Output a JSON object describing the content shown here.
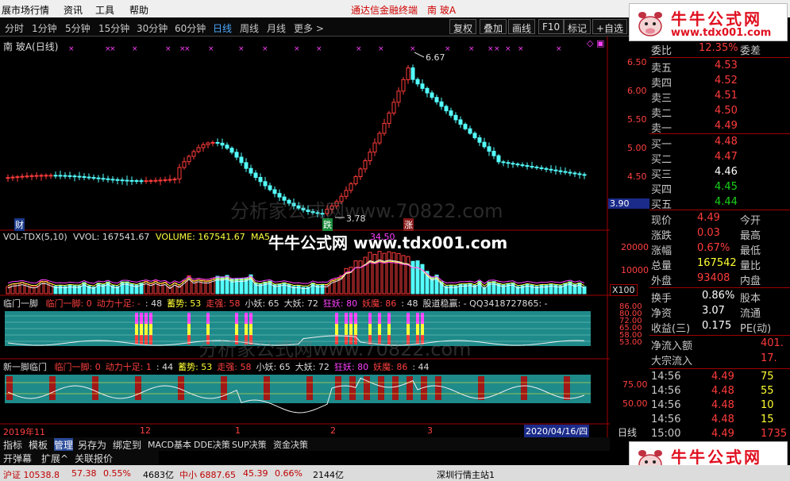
{
  "menubar": {
    "items": [
      "展市场行情",
      "资讯",
      "工具",
      "帮助"
    ],
    "center_title": "通达信金融终端",
    "stock_title": "南 玻A"
  },
  "toolbar": {
    "periods": [
      "分时",
      "1分钟",
      "5分钟",
      "15分钟",
      "30分钟",
      "60分钟",
      "日线",
      "周线",
      "月线",
      "更多 >"
    ],
    "active_period": "日线",
    "buttons": [
      "复权",
      "叠加",
      "画线",
      "F10",
      "标记",
      "+自选"
    ]
  },
  "logo": {
    "line1": "牛牛公式网",
    "line2": "www.tdx001.com"
  },
  "watermark": {
    "main": "牛牛公式网 www.tdx001.com",
    "faint1": "分析家公式网www.70822.com",
    "faint2": "分析家公式网www.70822.com"
  },
  "chart": {
    "title": "南 玻A(日线)",
    "price_axis": [
      "6.50",
      "6.00",
      "5.50",
      "5.00",
      "4.50"
    ],
    "current_price_tag": "3.90",
    "high_label": "6.67",
    "low_label": "3.78",
    "tag_cai": "财",
    "tag_die": "跌",
    "tag_zhang": "涨",
    "vol_header": {
      "name": "VOL-TDX(5,10)",
      "vvol": "VVOL: 167541.67",
      "volume": "VOLUME: 167541.67",
      "ma5": "MA5",
      "ma10_tail": "34.50"
    },
    "vol_axis": [
      "20000",
      "10000"
    ],
    "vol_unit": "X100",
    "ind1": {
      "name": "临门一脚",
      "items": [
        {
          "text": "临门一脚: 0",
          "color": "#ff4040"
        },
        {
          "text": "动力十足: -",
          "color": "#ff4040"
        },
        {
          "text": ": 48",
          "color": "#dddddd"
        },
        {
          "text": "蓄势: 53",
          "color": "#ffff33"
        },
        {
          "text": "走强: 58",
          "color": "#ff4040"
        },
        {
          "text": "小妖: 65",
          "color": "#dddddd"
        },
        {
          "text": "大妖: 72",
          "color": "#dddddd"
        },
        {
          "text": "狂妖: 80",
          "color": "#ff40ff"
        },
        {
          "text": "妖魔: 86",
          "color": "#ff4040"
        },
        {
          "text": ": 48",
          "color": "#dddddd"
        },
        {
          "text": "股道稳赢: - QQ3418727865: -",
          "color": "#dddddd"
        }
      ],
      "axis": [
        "86.00",
        "80.00",
        "72.00",
        "65.00",
        "58.00",
        "53.00"
      ]
    },
    "ind2": {
      "name": "新一脚临门",
      "items": [
        {
          "text": "临门一脚: 0",
          "color": "#ff4040"
        },
        {
          "text": "动力十足: 1",
          "color": "#ff4040"
        },
        {
          "text": ": 44",
          "color": "#dddddd"
        },
        {
          "text": "蓄势: 53",
          "color": "#ffff33"
        },
        {
          "text": "走强: 58",
          "color": "#ff4040"
        },
        {
          "text": "小妖: 65",
          "color": "#dddddd"
        },
        {
          "text": "大妖: 72",
          "color": "#dddddd"
        },
        {
          "text": "狂妖: 80",
          "color": "#ff40ff"
        },
        {
          "text": "妖魔: 86",
          "color": "#ff4040"
        },
        {
          "text": ": 44",
          "color": "#dddddd"
        }
      ],
      "axis": [
        "75.00",
        "50.00"
      ]
    },
    "date_axis": {
      "start": "2019年11",
      "m12": "12",
      "m1": "1",
      "m2": "2",
      "m3": "3",
      "cursor_date": "2020/04/16/四",
      "period": "日线"
    }
  },
  "quote": {
    "weibi": {
      "label": "委比",
      "value": "12.35%",
      "label2": "委差"
    },
    "asks": [
      {
        "label": "卖五",
        "price": "4.53"
      },
      {
        "label": "卖四",
        "price": "4.52"
      },
      {
        "label": "卖三",
        "price": "4.51"
      },
      {
        "label": "卖二",
        "price": "4.50"
      },
      {
        "label": "卖一",
        "price": "4.49"
      }
    ],
    "bids": [
      {
        "label": "买一",
        "price": "4.48",
        "color": "red"
      },
      {
        "label": "买二",
        "price": "4.47",
        "color": "red"
      },
      {
        "label": "买三",
        "price": "4.46",
        "color": "white"
      },
      {
        "label": "买四",
        "price": "4.45",
        "color": "green"
      },
      {
        "label": "买五",
        "price": "4.44",
        "color": "green"
      }
    ],
    "stats": [
      {
        "l1": "现价",
        "v": "4.49",
        "vc": "red",
        "l2": "今开"
      },
      {
        "l1": "涨跌",
        "v": "0.03",
        "vc": "red",
        "l2": "最高"
      },
      {
        "l1": "涨幅",
        "v": "0.67%",
        "vc": "red",
        "l2": "最低"
      },
      {
        "l1": "总量",
        "v": "167542",
        "vc": "yellow",
        "l2": "量比"
      },
      {
        "l1": "外盘",
        "v": "93408",
        "vc": "red",
        "l2": "内盘"
      }
    ],
    "stats2": [
      {
        "l1": "换手",
        "v": "0.86%",
        "vc": "white",
        "l2": "股本"
      },
      {
        "l1": "净资",
        "v": "3.07",
        "vc": "white",
        "l2": "流通"
      },
      {
        "l1": "收益(三)",
        "v": "0.175",
        "vc": "white",
        "l2": "PE(动)"
      }
    ],
    "flow": [
      {
        "label": "净流入额",
        "value": "401."
      },
      {
        "label": "大宗流入",
        "value": "17."
      }
    ],
    "ticks": [
      {
        "time": "14:56",
        "price": "4.49",
        "vol": "75",
        "vc": "yellow"
      },
      {
        "time": "14:56",
        "price": "4.48",
        "vol": "55",
        "vc": "yellow"
      },
      {
        "time": "14:56",
        "price": "4.48",
        "vol": "10",
        "vc": "yellow"
      },
      {
        "time": "14:56",
        "price": "4.48",
        "vol": "15",
        "vc": "yellow"
      },
      {
        "time": "15:00",
        "price": "4.49",
        "vol": "1735",
        "vc": "magenta"
      }
    ]
  },
  "tabs1": [
    "指标",
    "模板",
    "管理",
    "另存为",
    "绑定到",
    "MACD基本",
    "DDE决策",
    "SUP决策",
    "资金决策"
  ],
  "tabs2": [
    "开弹幕",
    "扩展^",
    "关联报价"
  ],
  "status": {
    "idx1": "沪证 10538.8",
    "idx1_chg": "57.38",
    "idx1_pct": "0.55%",
    "idx1_amt": "4683亿",
    "idx2": "中小 6887.65",
    "idx2_chg": "45.39",
    "idx2_pct": "0.66%",
    "idx2_amt": "2144亿",
    "right": "深圳行情主站1"
  }
}
